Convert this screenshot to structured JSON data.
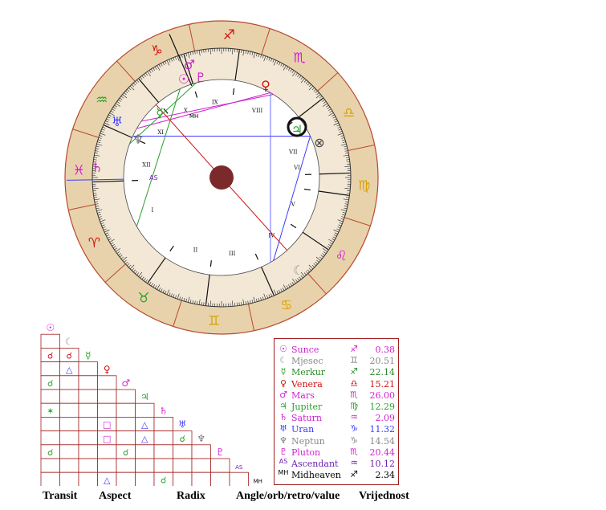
{
  "colors": {
    "ring": "#e8d2ac",
    "ring_stroke": "#b84a2e",
    "inner_band": "#f3e8d6",
    "earth": "#7a2a2a"
  },
  "zodiac": [
    {
      "glyph": "♏",
      "color": "#d11fd1"
    },
    {
      "glyph": "♎",
      "color": "#d8a200"
    },
    {
      "glyph": "♍",
      "color": "#d8a200"
    },
    {
      "glyph": "♌",
      "color": "#d11fd1"
    },
    {
      "glyph": "♋",
      "color": "#d8a200"
    },
    {
      "glyph": "♊",
      "color": "#d8a200"
    },
    {
      "glyph": "♉",
      "color": "#2aa02a"
    },
    {
      "glyph": "♈",
      "color": "#d11010"
    },
    {
      "glyph": "♓",
      "color": "#d11fd1"
    },
    {
      "glyph": "♒",
      "color": "#2aa02a"
    },
    {
      "glyph": "♑",
      "color": "#d11010"
    },
    {
      "glyph": "♐",
      "color": "#d11010"
    }
  ],
  "houses": [
    "I",
    "II",
    "III",
    "IV",
    "V",
    "VI",
    "VII",
    "VIII",
    "IX",
    "X",
    "XI",
    "XII"
  ],
  "labels": {
    "as": "AS",
    "mh": "MH"
  },
  "planets_in_ring": [
    {
      "glyph": "♂",
      "color": "#d11fd1",
      "name": "mars"
    },
    {
      "glyph": "♀",
      "color": "#d11010",
      "name": "venus"
    },
    {
      "glyph": "☉",
      "color": "#d11fd1",
      "name": "sun"
    },
    {
      "glyph": "♇",
      "color": "#d11fd1",
      "name": "pluto"
    },
    {
      "glyph": "☿",
      "color": "#2aa02a",
      "name": "mercury"
    },
    {
      "glyph": "♅",
      "color": "#3b3bff",
      "name": "uranus"
    },
    {
      "glyph": "♆",
      "color": "#777777",
      "name": "neptune"
    },
    {
      "glyph": "♄",
      "color": "#d11fd1",
      "name": "saturn"
    },
    {
      "glyph": "♃",
      "color": "#2aa02a",
      "name": "jupiter"
    },
    {
      "glyph": "☾",
      "color": "#999999",
      "name": "moon"
    },
    {
      "glyph": "⊗",
      "color": "#444444",
      "name": "fortune"
    }
  ],
  "grid": {
    "headers": [
      {
        "glyph": "☉",
        "color": "#d11fd1"
      },
      {
        "glyph": "☾",
        "color": "#999999"
      },
      {
        "glyph": "☿",
        "color": "#2aa02a"
      },
      {
        "glyph": "♀",
        "color": "#d11010"
      },
      {
        "glyph": "♂",
        "color": "#d11fd1"
      },
      {
        "glyph": "♃",
        "color": "#2aa02a"
      },
      {
        "glyph": "♄",
        "color": "#d11fd1"
      },
      {
        "glyph": "♅",
        "color": "#3b3bff"
      },
      {
        "glyph": "♆",
        "color": "#777777"
      },
      {
        "glyph": "♇",
        "color": "#d11fd1"
      },
      {
        "glyph": "AS",
        "color": "#6a1fb0"
      },
      {
        "glyph": "MH",
        "color": "#000000"
      }
    ],
    "cells": [
      {
        "r": 2,
        "c": 0,
        "glyph": "☌",
        "color": "#d11010"
      },
      {
        "r": 2,
        "c": 1,
        "glyph": "☌",
        "color": "#d11010"
      },
      {
        "r": 3,
        "c": 1,
        "glyph": "△",
        "color": "#3b3bff"
      },
      {
        "r": 4,
        "c": 0,
        "glyph": "☌",
        "color": "#2aa02a"
      },
      {
        "r": 6,
        "c": 0,
        "glyph": "✶",
        "color": "#2aa02a"
      },
      {
        "r": 7,
        "c": 3,
        "glyph": "□",
        "color": "#d11fd1"
      },
      {
        "r": 7,
        "c": 5,
        "glyph": "△",
        "color": "#3b3bff"
      },
      {
        "r": 8,
        "c": 3,
        "glyph": "□",
        "color": "#d11fd1"
      },
      {
        "r": 8,
        "c": 5,
        "glyph": "△",
        "color": "#3b3bff"
      },
      {
        "r": 8,
        "c": 7,
        "glyph": "☌",
        "color": "#2aa02a"
      },
      {
        "r": 9,
        "c": 0,
        "glyph": "☌",
        "color": "#2aa02a"
      },
      {
        "r": 9,
        "c": 4,
        "glyph": "☌",
        "color": "#2aa02a"
      },
      {
        "r": 11,
        "c": 3,
        "glyph": "△",
        "color": "#3b3bff"
      },
      {
        "r": 11,
        "c": 6,
        "glyph": "☌",
        "color": "#2aa02a"
      }
    ]
  },
  "legend": [
    {
      "glyph": "☉",
      "gcolor": "#d11fd1",
      "name": "Sunce",
      "ncolor": "#d11fd1",
      "sign": "♐",
      "scolor": "#d11fd1",
      "value": "0.38",
      "vcolor": "#d11fd1"
    },
    {
      "glyph": "☾",
      "gcolor": "#999999",
      "name": "Mjesec",
      "ncolor": "#888888",
      "sign": "♊",
      "scolor": "#888888",
      "value": "20.51",
      "vcolor": "#888888"
    },
    {
      "glyph": "☿",
      "gcolor": "#2aa02a",
      "name": "Merkur",
      "ncolor": "#2a8a2a",
      "sign": "♐",
      "scolor": "#2a8a2a",
      "value": "22.14",
      "vcolor": "#2a8a2a"
    },
    {
      "glyph": "♀",
      "gcolor": "#d11010",
      "name": "Venera",
      "ncolor": "#d11010",
      "sign": "♎",
      "scolor": "#d11010",
      "value": "15.21",
      "vcolor": "#d11010"
    },
    {
      "glyph": "♂",
      "gcolor": "#d11fd1",
      "name": "Mars",
      "ncolor": "#d11fd1",
      "sign": "♏",
      "scolor": "#d11fd1",
      "value": "26.00",
      "vcolor": "#d11fd1"
    },
    {
      "glyph": "♃",
      "gcolor": "#2aa02a",
      "name": "Jupiter",
      "ncolor": "#2aa02a",
      "sign": "♍",
      "scolor": "#2aa02a",
      "value": "12.29",
      "vcolor": "#2aa02a"
    },
    {
      "glyph": "♄",
      "gcolor": "#d11fd1",
      "name": "Saturn",
      "ncolor": "#d11fd1",
      "sign": "♒",
      "scolor": "#d11fd1",
      "value": "2.09",
      "vcolor": "#d11fd1"
    },
    {
      "glyph": "♅",
      "gcolor": "#3b3bff",
      "name": "Uran",
      "ncolor": "#3b3bff",
      "sign": "♑",
      "scolor": "#3b3bff",
      "value": "11.32",
      "vcolor": "#3b3bff"
    },
    {
      "glyph": "♆",
      "gcolor": "#777777",
      "name": "Neptun",
      "ncolor": "#888888",
      "sign": "♑",
      "scolor": "#888888",
      "value": "14.54",
      "vcolor": "#888888"
    },
    {
      "glyph": "♇",
      "gcolor": "#d11fd1",
      "name": "Pluton",
      "ncolor": "#d11fd1",
      "sign": "♏",
      "scolor": "#d11fd1",
      "value": "20.44",
      "vcolor": "#d11fd1"
    },
    {
      "glyph": "AS",
      "gcolor": "#6a1fb0",
      "name": "Ascendant",
      "ncolor": "#6a1fb0",
      "sign": "♒",
      "scolor": "#6a1fb0",
      "value": "10.12",
      "vcolor": "#6a1fb0"
    },
    {
      "glyph": "MH",
      "gcolor": "#000000",
      "name": "Midheaven",
      "ncolor": "#000000",
      "sign": "♐",
      "scolor": "#000000",
      "value": "2.34",
      "vcolor": "#000000"
    }
  ],
  "footer": {
    "transit": "Transit",
    "aspect": "Aspect",
    "radix": "Radix",
    "angle": "Angle/orb/retro/value",
    "vrijednost": "Vrijednost"
  }
}
